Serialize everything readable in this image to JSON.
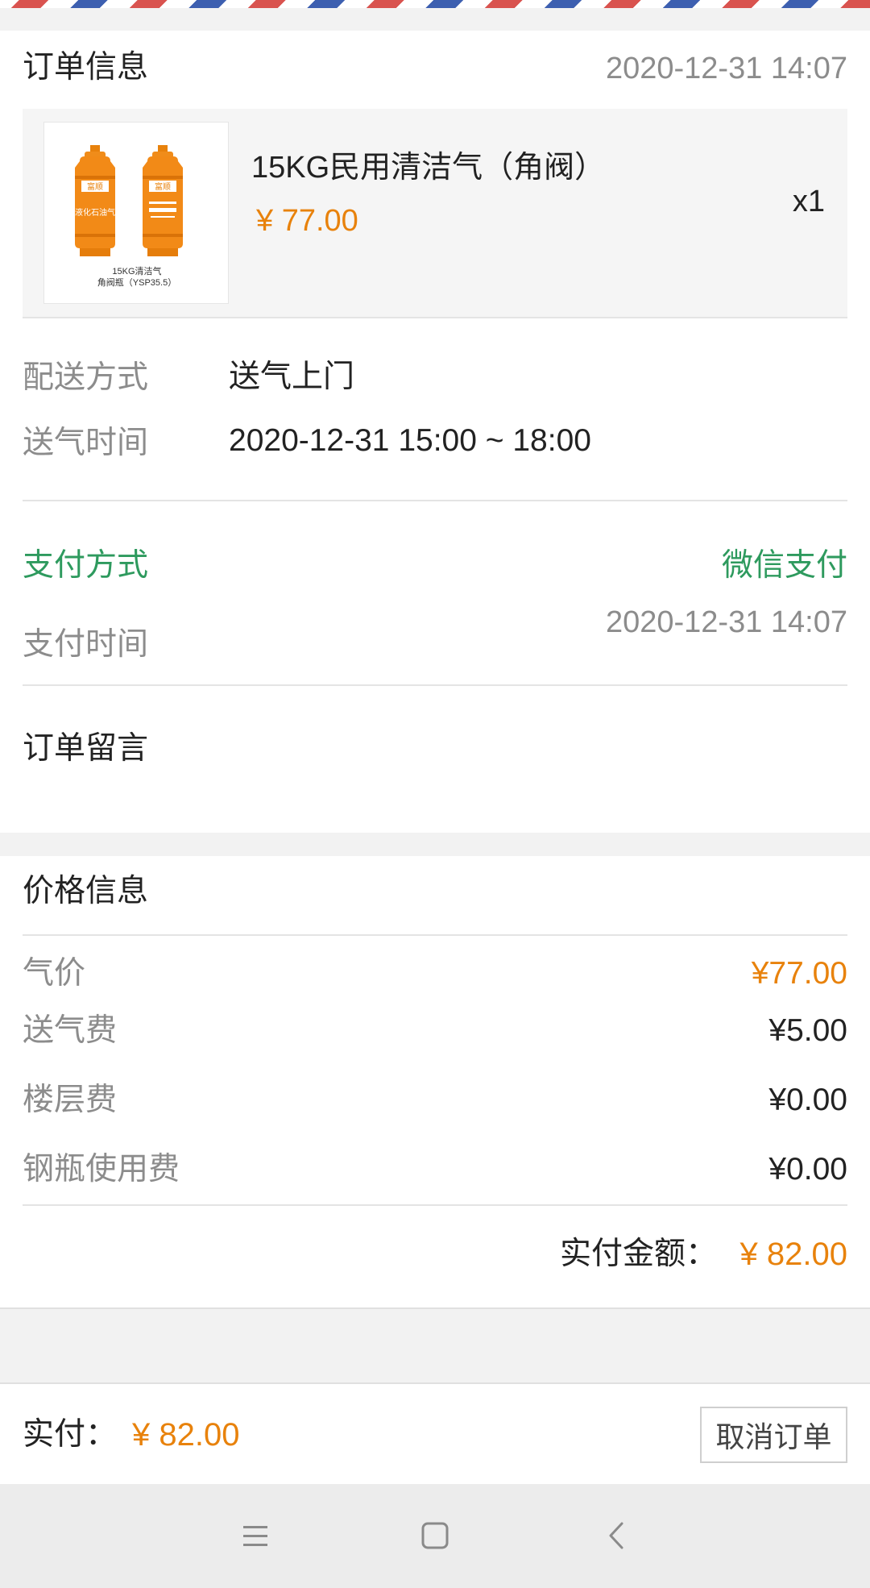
{
  "order": {
    "title": "订单信息",
    "datetime": "2020-12-31 14:07",
    "product": {
      "name": "15KG民用清洁气（角阀）",
      "price": "¥ 77.00",
      "quantity": "x1",
      "image_caption_line1": "15KG清洁气",
      "image_caption_line2": "角阀瓶（YSP35.5）",
      "image_brand": "富顺",
      "image_label": "液化石油气"
    },
    "delivery_method_label": "配送方式",
    "delivery_method_value": "送气上门",
    "delivery_time_label": "送气时间",
    "delivery_time_value": "2020-12-31 15:00 ~ 18:00",
    "payment_method_label": "支付方式",
    "payment_method_value": "微信支付",
    "payment_time_label": "支付时间",
    "payment_time_value": "2020-12-31 14:07",
    "message_label": "订单留言"
  },
  "price": {
    "title": "价格信息",
    "items": [
      {
        "label": "气价",
        "value": "¥77.00"
      },
      {
        "label": "送气费",
        "value": "¥5.00"
      },
      {
        "label": "楼层费",
        "value": "¥0.00"
      },
      {
        "label": "钢瓶使用费",
        "value": "¥0.00"
      }
    ],
    "total_label": "实付金额：",
    "total_value": "¥ 82.00"
  },
  "footer": {
    "paid_label": "实付：",
    "paid_value": "¥ 82.00",
    "cancel_label": "取消订单"
  },
  "colors": {
    "accent_orange": "#e8820c",
    "accent_green": "#2e9a5e"
  },
  "nav": {
    "icons": [
      "menu-icon",
      "home-square-icon",
      "back-chevron-icon"
    ]
  }
}
